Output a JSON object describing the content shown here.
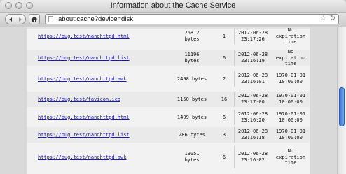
{
  "window": {
    "title": "Information about the Cache Service"
  },
  "toolbar": {
    "url": "about:cache?device=disk"
  },
  "rows": [
    {
      "link": "https://bug.test/nanohttpd.html",
      "size_top": "26812",
      "size_bottom": "bytes",
      "count": "1",
      "mod_date": "2012-06-28",
      "mod_time": "23:17:26",
      "exp_top": "No",
      "exp_mid": "expiration",
      "exp_bottom": "time"
    },
    {
      "link": "https://bug.test/nanohttpd.list",
      "size_top": "11196",
      "size_bottom": "bytes",
      "count": "6",
      "mod_date": "2012-06-28",
      "mod_time": "23:16:19",
      "exp_top": "No",
      "exp_mid": "expiration",
      "exp_bottom": "time"
    },
    {
      "link": "https://bug.test/nanohttpd.awk",
      "size_top": "2498 bytes",
      "size_bottom": "",
      "count": "2",
      "mod_date": "2012-06-28",
      "mod_time": "23:16:01",
      "exp_top": "1970-01-01",
      "exp_mid": "10:00:00",
      "exp_bottom": ""
    },
    {
      "link": "https://bug.test/favicon.ico",
      "size_top": "1150 bytes",
      "size_bottom": "",
      "count": "16",
      "mod_date": "2012-06-28",
      "mod_time": "23:17:00",
      "exp_top": "1970-01-01",
      "exp_mid": "10:00:00",
      "exp_bottom": ""
    },
    {
      "link": "https://bug.test/nanohttpd.html",
      "size_top": "1409 bytes",
      "size_bottom": "",
      "count": "6",
      "mod_date": "2012-06-28",
      "mod_time": "23:16:20",
      "exp_top": "1970-01-01",
      "exp_mid": "10:00:00",
      "exp_bottom": ""
    },
    {
      "link": "https://bug.test/nanohttpd.list",
      "size_top": "286 bytes",
      "size_bottom": "",
      "count": "3",
      "mod_date": "2012-06-28",
      "mod_time": "23:16:18",
      "exp_top": "1970-01-01",
      "exp_mid": "10:00:00",
      "exp_bottom": ""
    },
    {
      "link": "https://bug.test/nanohttpd.awk",
      "size_top": "19051",
      "size_bottom": "bytes",
      "count": "6",
      "mod_date": "2012-06-28",
      "mod_time": "23:16:02",
      "exp_top": "No",
      "exp_mid": "expiration",
      "exp_bottom": "time"
    }
  ]
}
